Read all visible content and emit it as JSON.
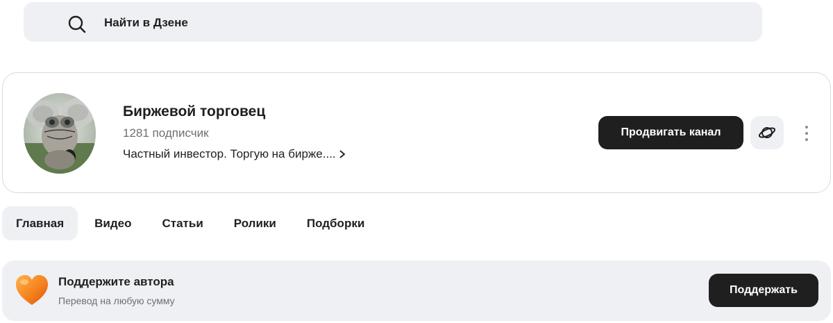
{
  "search": {
    "placeholder": "Найти в Дзене",
    "icon": "search-icon"
  },
  "channel": {
    "title": "Биржевой торговец",
    "subscribers": "1281 подписчик",
    "description": "Частный инвестор. Торгую на бирже....",
    "promote_label": "Продвигать канал",
    "planet_icon": "planet-icon",
    "more_icon": "more-vertical-icon",
    "avatar": "avatar"
  },
  "tabs": [
    {
      "label": "Главная",
      "active": true
    },
    {
      "label": "Видео",
      "active": false
    },
    {
      "label": "Статьи",
      "active": false
    },
    {
      "label": "Ролики",
      "active": false
    },
    {
      "label": "Подборки",
      "active": false
    }
  ],
  "support": {
    "title": "Поддержите автора",
    "subtitle": "Перевод на любую сумму",
    "button_label": "Поддержать",
    "icon": "heart-icon"
  },
  "colors": {
    "background": "#ffffff",
    "panel": "#eef0f3",
    "primary_button": "#1f1f1f",
    "text": "#1f1f1f",
    "muted_text": "#6d6f74",
    "heart": "#f5821f"
  }
}
